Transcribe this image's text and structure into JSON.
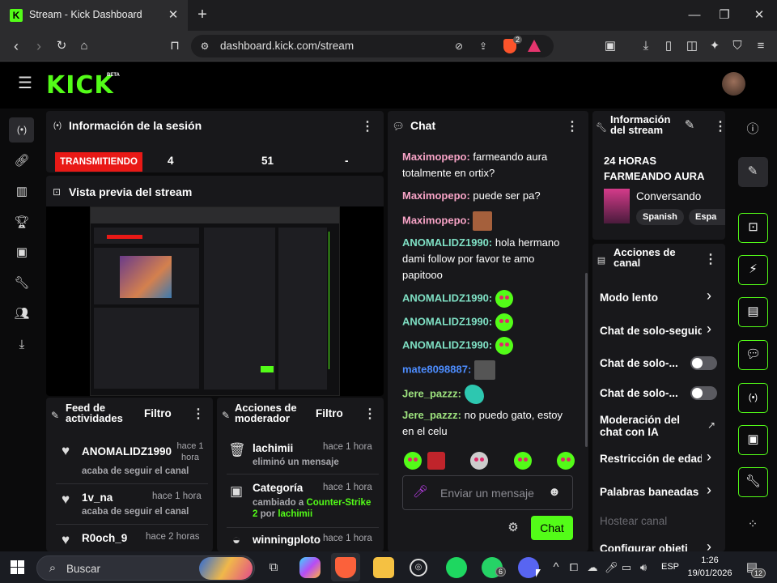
{
  "browser": {
    "tab_title": "Stream - Kick Dashboard",
    "new_tab": "+",
    "url": "dashboard.kick.com/stream",
    "shield_badge": "2",
    "window_controls": {
      "minimize": "—",
      "maximize": "❐",
      "close": "✕"
    }
  },
  "app": {
    "logo": "KICK",
    "logo_badge": "BETA"
  },
  "session": {
    "title": "Información de la sesión",
    "live_label": "TRANSMITIENDO",
    "stat1": "4",
    "stat2": "51",
    "stat3": "-"
  },
  "preview": {
    "title": "Vista previa del stream"
  },
  "activity": {
    "title": "Feed de actividades",
    "filter": "Filtro",
    "items": [
      {
        "user": "ANOMALIDZ1990",
        "time": "hace 1 hora",
        "desc": "acaba de seguir el canal"
      },
      {
        "user": "1v_na",
        "time": "hace 1 hora",
        "desc": "acaba de seguir el canal"
      },
      {
        "user": "R0och_9",
        "time": "hace 2 horas",
        "desc": ""
      }
    ]
  },
  "mod": {
    "title": "Acciones de moderador",
    "filter": "Filtro",
    "items": [
      {
        "user": "lachimii",
        "time": "hace 1 hora",
        "desc": "eliminó un mensaje"
      },
      {
        "user": "Categoría",
        "time": "hace 1 hora",
        "desc_pre": "cambiado a ",
        "desc_hl": "Counter-Strike 2",
        "desc_mid": " por ",
        "desc_user": "lachimii"
      },
      {
        "user": "winningploto",
        "time": "hace 1 hora",
        "desc": ""
      }
    ]
  },
  "chat": {
    "title": "Chat",
    "messages": [
      {
        "user": "Maximopepo:",
        "text": "farmeando aura totalmente en ortix?"
      },
      {
        "user": "Maximopepo:",
        "text": "puede ser pa?"
      },
      {
        "user": "Maximopepo:",
        "text": ""
      },
      {
        "user": "ANOMALIDZ1990:",
        "text": "hola hermano dami follow por favor te amo papitooo"
      },
      {
        "user": "ANOMALIDZ1990:",
        "text": ""
      },
      {
        "user": "ANOMALIDZ1990:",
        "text": ""
      },
      {
        "user": "ANOMALIDZ1990:",
        "text": ""
      },
      {
        "user": "mate8098887:",
        "text": ""
      },
      {
        "user": "Jere_pazzz:",
        "text": ""
      },
      {
        "user": "Jere_pazzz:",
        "text": "no puedo gato, estoy en el celu"
      }
    ],
    "input_placeholder": "Enviar un mensaje",
    "send_label": "Chat"
  },
  "stream_info": {
    "title": "Información del stream",
    "stream_title": "24 HORAS FARMEANDO AURA",
    "category": "Conversando",
    "tags": [
      "Spanish",
      "Espa"
    ]
  },
  "channel_actions": {
    "title": "Acciones de canal",
    "items": [
      {
        "label": "Modo lento",
        "control": "chevron"
      },
      {
        "label": "Chat de solo-seguid",
        "control": "chevron"
      },
      {
        "label": "Chat de solo-...",
        "control": "toggle"
      },
      {
        "label": "Chat de solo-...",
        "control": "toggle"
      },
      {
        "label": "Moderación del chat con IA",
        "control": "external"
      },
      {
        "label": "Restricción de edad",
        "control": "chevron"
      },
      {
        "label": "Palabras baneadas",
        "control": "chevron"
      },
      {
        "label": "Hostear canal",
        "control": "none"
      },
      {
        "label": "Configurar objeti",
        "control": "chevron"
      }
    ]
  },
  "taskbar": {
    "search": "Buscar",
    "lang": "ESP",
    "time": "1:26",
    "date": "19/01/2026",
    "whatsapp_badge": "6",
    "notif_badge": "12"
  },
  "colors": {
    "accent": "#53fc18",
    "live": "#e91916",
    "panel": "#18181b"
  }
}
